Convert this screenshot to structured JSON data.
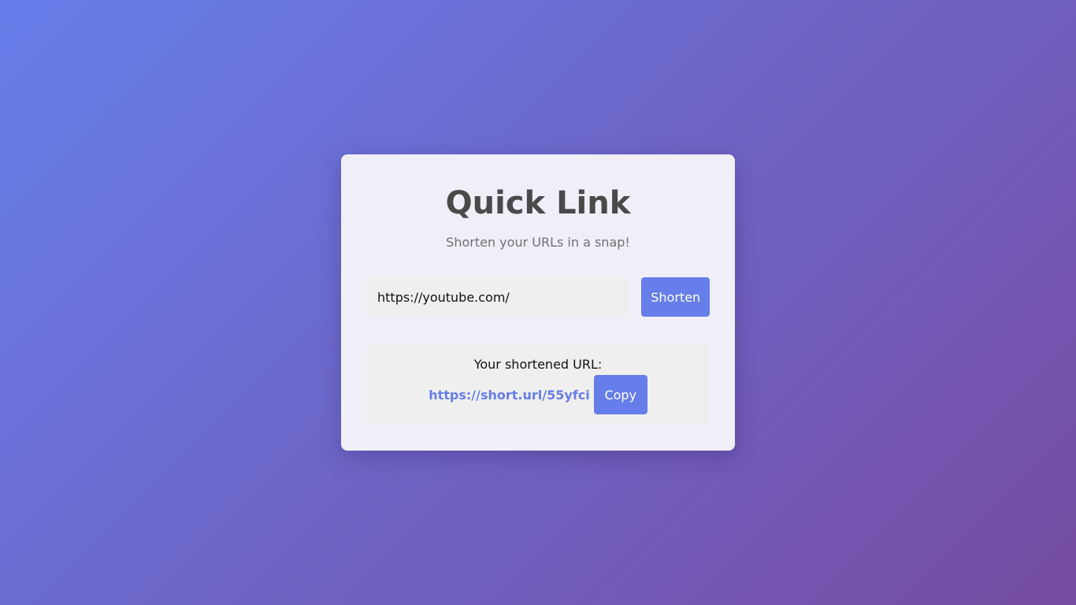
{
  "app": {
    "title": "Quick Link",
    "subtitle": "Shorten your URLs in a snap!"
  },
  "form": {
    "url_value": "https://youtube.com/",
    "shorten_label": "Shorten"
  },
  "result": {
    "label": "Your shortened URL:",
    "short_url": "https://short.url/55yfci",
    "copy_label": "Copy"
  },
  "colors": {
    "accent": "#667eea",
    "gradient_start": "#667eea",
    "gradient_end": "#764ba2",
    "card_background": "#f0eff8",
    "title_text": "#4a4a4a"
  }
}
